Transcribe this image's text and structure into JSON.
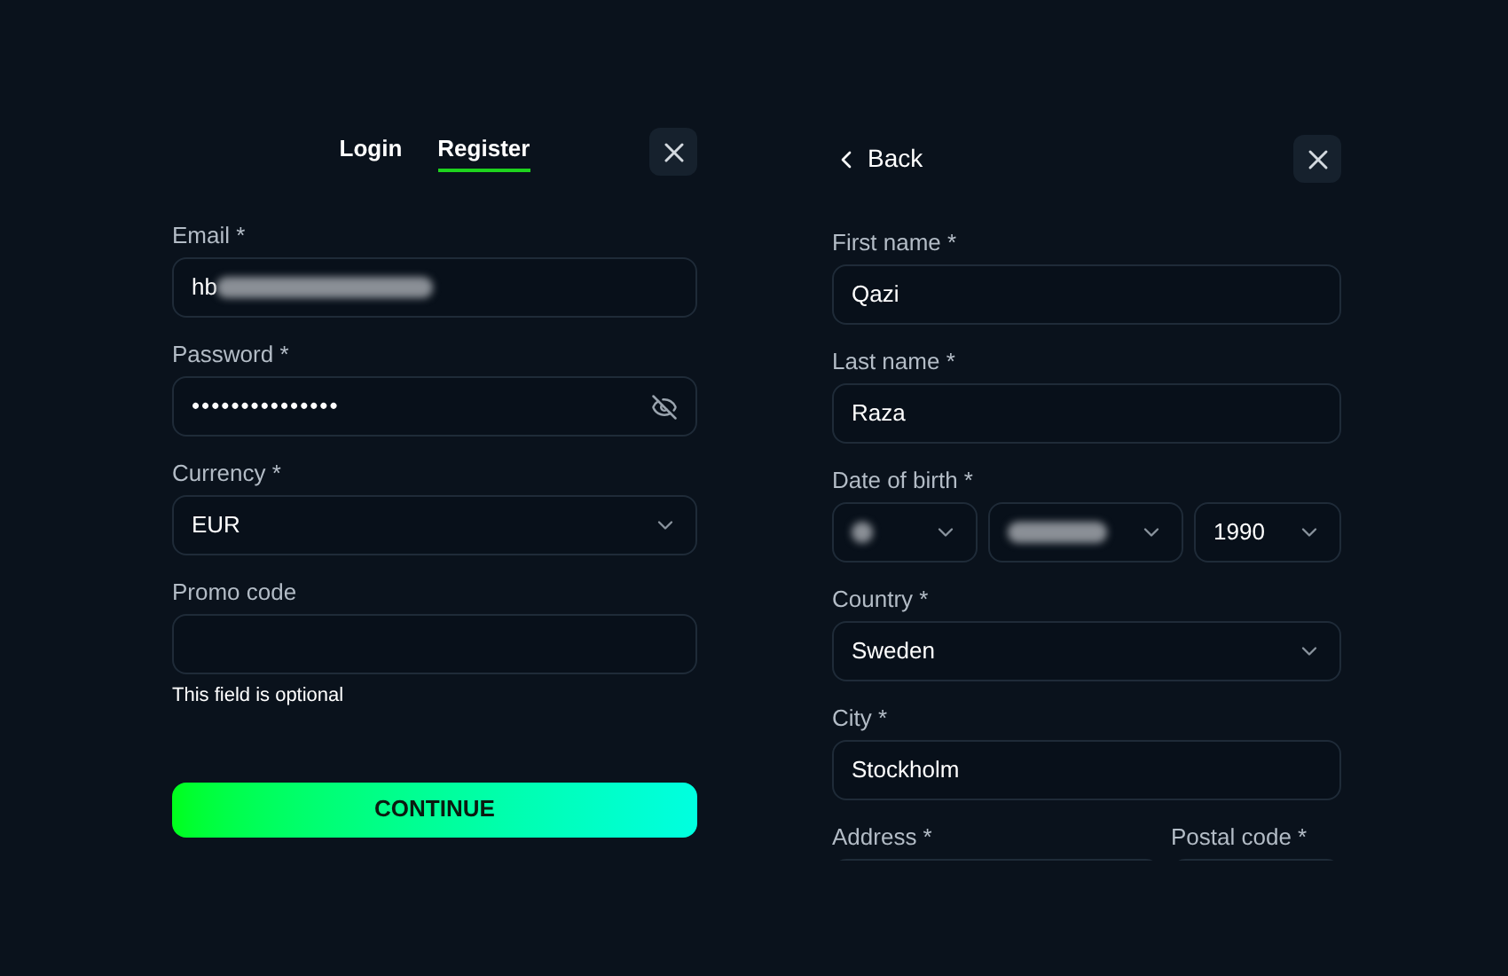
{
  "login_panel": {
    "tabs": [
      {
        "label": "Login",
        "selected": false
      },
      {
        "label": "Register",
        "selected": true
      }
    ],
    "fields": [
      {
        "kind": "text",
        "label": "Email *",
        "value": "hb",
        "redacted": true
      },
      {
        "kind": "password",
        "label": "Password *",
        "value": "•••••••••••••••"
      },
      {
        "kind": "select",
        "label": "Currency *",
        "value": "EUR"
      },
      {
        "kind": "text",
        "label": "Promo code",
        "hint": "This field is optional"
      }
    ],
    "submit": "CONTINUE"
  },
  "details_panel": {
    "back": "Back",
    "fields": [
      {
        "kind": "text",
        "label": "First name *",
        "value": "Qazi"
      },
      {
        "kind": "text",
        "label": "Last name *",
        "value": "Raza"
      },
      {
        "kind": "date",
        "label": "Date of birth *",
        "parts": [
          {
            "redacted": true
          },
          {
            "redacted": true
          },
          {
            "value": "1990",
            "redacted": false
          }
        ]
      },
      {
        "kind": "select",
        "label": "Country *",
        "value": "Sweden"
      },
      {
        "kind": "text",
        "label": "City *",
        "value": "Stockholm"
      },
      {
        "kind": "pair",
        "items": [
          {
            "label": "Address *"
          },
          {
            "label": "Postal code *"
          }
        ]
      }
    ]
  }
}
